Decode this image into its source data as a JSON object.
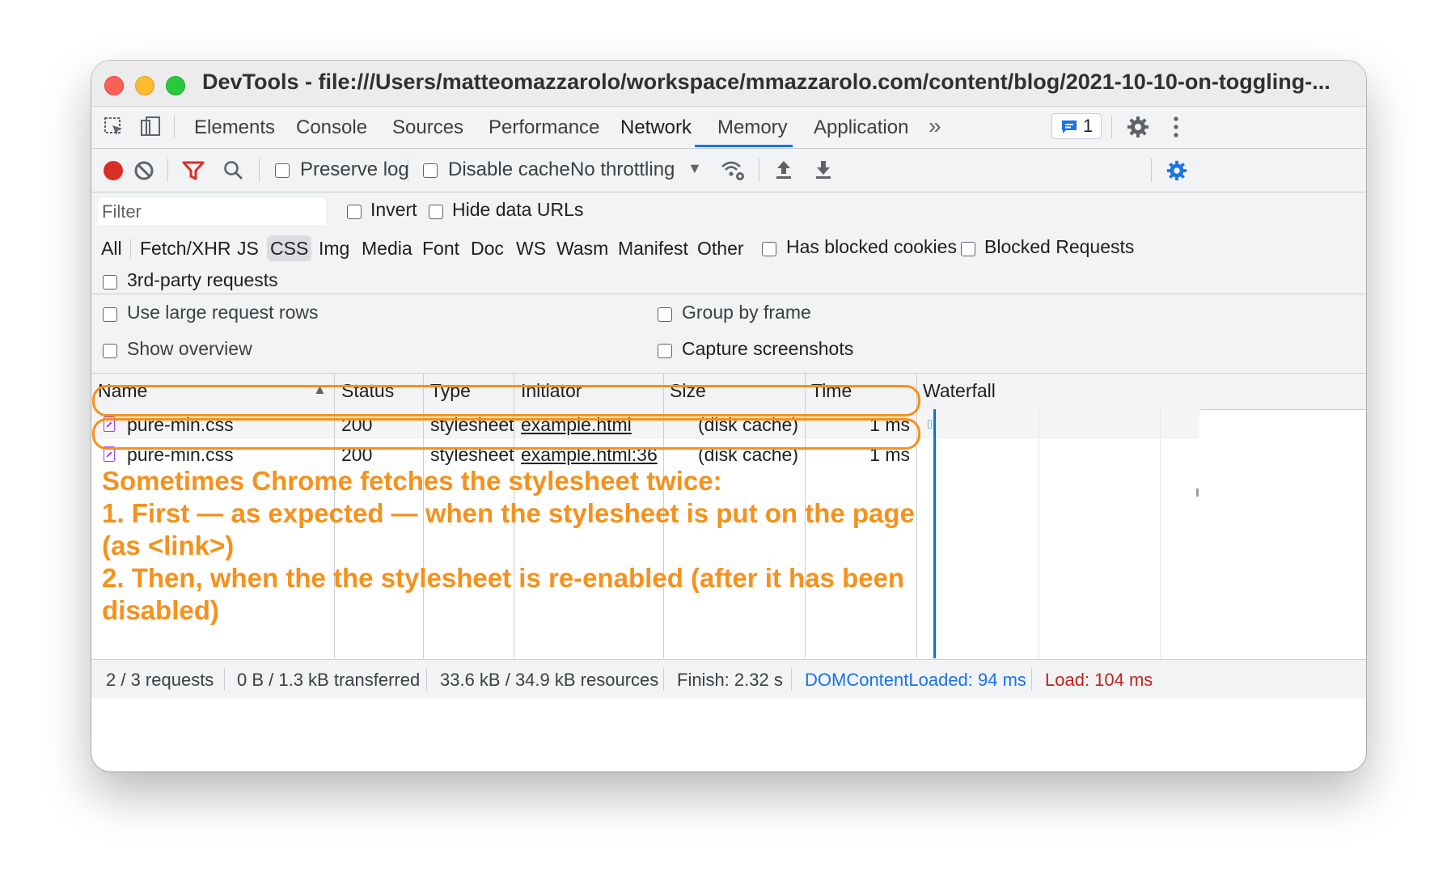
{
  "window": {
    "title": "DevTools - file:///Users/matteomazzarolo/workspace/mmazzarolo.com/content/blog/2021-10-10-on-toggling-..."
  },
  "tabs": [
    "Elements",
    "Console",
    "Sources",
    "Performance",
    "Network",
    "Memory",
    "Application"
  ],
  "active_tab": "Network",
  "more_tabs_label": "»",
  "issues_badge": {
    "count": "1",
    "icon": "message-icon"
  },
  "toolbar": {
    "preserve_log": "Preserve log",
    "disable_cache": "Disable cache",
    "throttling": "No throttling",
    "throttling_caret": "▼"
  },
  "filter": {
    "placeholder": "Filter",
    "invert": "Invert",
    "hide_data_urls": "Hide data URLs",
    "types": [
      "All",
      "Fetch/XHR",
      "JS",
      "CSS",
      "Img",
      "Media",
      "Font",
      "Doc",
      "WS",
      "Wasm",
      "Manifest",
      "Other"
    ],
    "active_type": "CSS",
    "has_blocked_cookies": "Has blocked cookies",
    "blocked_requests": "Blocked Requests",
    "third_party": "3rd-party requests"
  },
  "settings": {
    "large_rows": "Use large request rows",
    "group_by_frame": "Group by frame",
    "show_overview": "Show overview",
    "capture_screenshots": "Capture screenshots"
  },
  "table": {
    "columns": [
      "Name",
      "Status",
      "Type",
      "Initiator",
      "Size",
      "Time",
      "Waterfall"
    ],
    "sort_indicator": "▲",
    "rows": [
      {
        "name": "pure-min.css",
        "status": "200",
        "type": "stylesheet",
        "initiator": "example.html",
        "size": "(disk cache)",
        "time": "1 ms"
      },
      {
        "name": "pure-min.css",
        "status": "200",
        "type": "stylesheet",
        "initiator": "example.html:36",
        "size": "(disk cache)",
        "time": "1 ms"
      }
    ]
  },
  "annotation": {
    "lines": [
      "Sometimes Chrome fetches the stylesheet twice:",
      "1. First — as expected —  when the stylesheet is put on the page",
      "(as <link>)",
      "2. Then, when the the stylesheet is re-enabled (after it has been",
      "disabled)"
    ]
  },
  "status": {
    "requests": "2 / 3 requests",
    "transferred": "0 B / 1.3 kB transferred",
    "resources": "33.6 kB / 34.9 kB resources",
    "finish": "Finish: 2.32 s",
    "dom_content_loaded": "DOMContentLoaded: 94 ms",
    "load": "Load: 104 ms"
  },
  "colors": {
    "accent": "#1a73e8",
    "annotation": "#f5911c",
    "record": "#d93025",
    "filter_icon": "#d93025",
    "dcl": "#1a73e8",
    "load": "#c5221f",
    "css_icon": "#a142f4"
  }
}
